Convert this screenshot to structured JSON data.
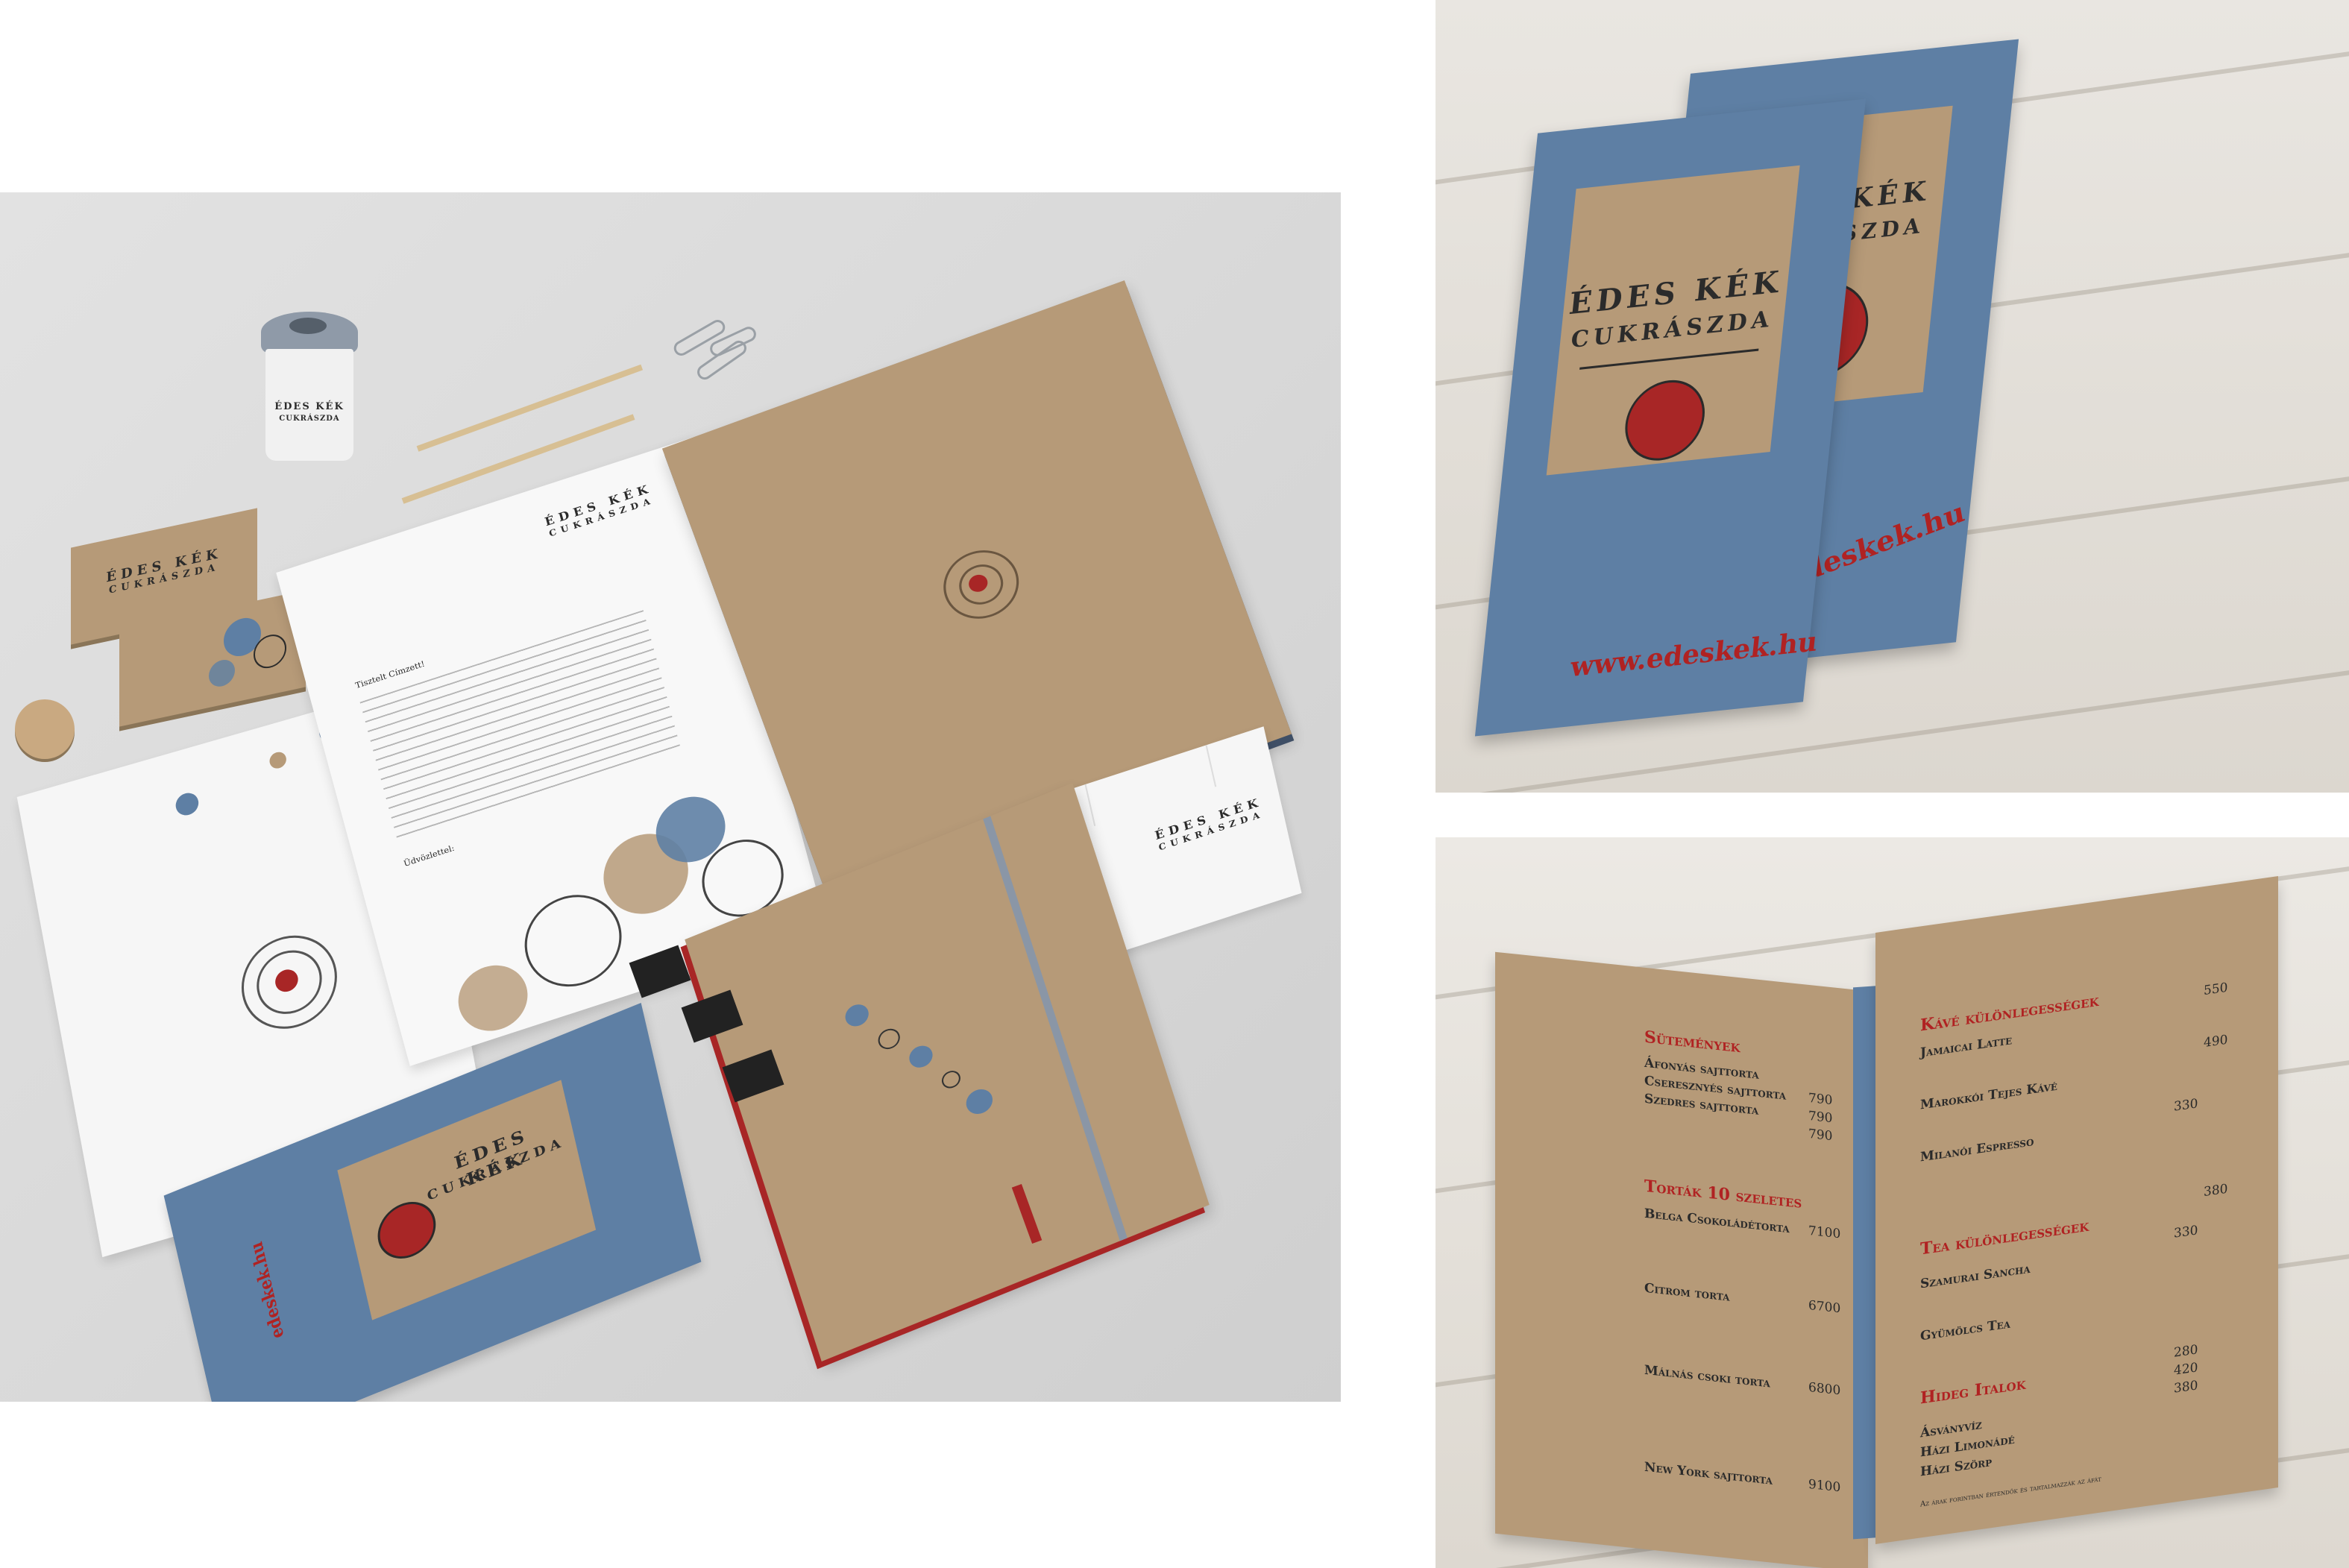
{
  "brand": {
    "logo_line1": "ÉDES KÉK",
    "logo_line2": "CUKRÁSZDA",
    "url": "www.edeskek.hu",
    "url_short": "edeskek.hu"
  },
  "colors": {
    "kraft": "#b69a78",
    "blue": "#5e7fa4",
    "red": "#a82626",
    "ink": "#2b2b2b"
  },
  "letter": {
    "greeting": "Tisztelt Címzett!",
    "closing": "Üdvözlettel:"
  },
  "menu": {
    "left_page": {
      "section1": {
        "title": "Sütemények",
        "items": [
          {
            "name": "Áfonyás sajttorta",
            "price": ""
          },
          {
            "name": "Cseresznyés sajttorta",
            "price": "790"
          },
          {
            "name": "Szedres sajttorta",
            "price": "790"
          }
        ],
        "extra_price": "790"
      },
      "section2": {
        "title": "Torták 10 szeletes",
        "items": [
          {
            "name": "Belga Csokoládétorta",
            "price": "7100"
          },
          {
            "name": "Citrom torta",
            "price": "6700"
          },
          {
            "name": "Málnás csoki torta",
            "price": "6800"
          },
          {
            "name": "New York sajttorta",
            "price": "9100"
          }
        ]
      }
    },
    "right_page": {
      "section1": {
        "title": "Kávé különlegességek",
        "items": [
          {
            "name": "Jamaicai Latte",
            "price": "550"
          },
          {
            "name": "Marokkói Tejes Kávé",
            "price": "490"
          },
          {
            "name": "Milanói Espresso",
            "price": "330"
          }
        ]
      },
      "section2": {
        "title": "Tea különlegességek",
        "items": [
          {
            "name": "Szamurai Sancha",
            "price": "330"
          },
          {
            "name": "Gyümölcs Tea",
            "price": "380"
          }
        ]
      },
      "section3": {
        "title": "Hideg Italok",
        "items": [
          {
            "name": "Ásványvíz",
            "price": "280"
          },
          {
            "name": "Házi Limonádé",
            "price": "420"
          },
          {
            "name": "Házi Szörp",
            "price": "380"
          }
        ]
      },
      "footnote": "Az árak forintban értendők és tartalmazzák az áfát"
    }
  }
}
